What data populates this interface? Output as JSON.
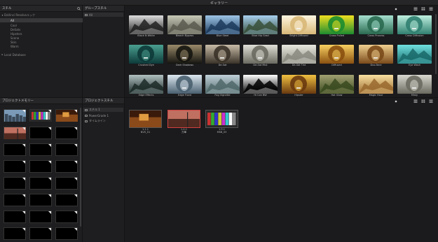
{
  "window": {
    "title": "ギャラリー"
  },
  "stills_panel": {
    "title": "スチル",
    "tree": [
      {
        "label": "DaVinci Resolveルック",
        "expanded": true,
        "selected": false
      },
      {
        "label": "All",
        "selected": true
      },
      {
        "label": "Cool",
        "selected": false
      },
      {
        "label": "DeSats",
        "selected": false
      },
      {
        "label": "Hipsters",
        "selected": false
      },
      {
        "label": "Scene",
        "selected": false
      },
      {
        "label": "Skin",
        "selected": false
      },
      {
        "label": "Warm",
        "selected": false
      },
      {
        "label": "Local Database",
        "expanded": false,
        "selected": false
      }
    ]
  },
  "group_stills_panel": {
    "title": "グループスチル",
    "groups": [
      {
        "label": "All"
      }
    ]
  },
  "looks": [
    {
      "label": "Black N White",
      "style": "bw"
    },
    {
      "label": "Bleach Bypass",
      "style": "bleach"
    },
    {
      "label": "Blue Steel",
      "style": "blue"
    },
    {
      "label": "Blue Hip Grad",
      "style": "bluegrad"
    },
    {
      "label": "Bright Diffused",
      "style": "bright"
    },
    {
      "label": "Cross Pulled",
      "style": "cross"
    },
    {
      "label": "Cross Process",
      "style": "crossproc"
    },
    {
      "label": "Cross Diffusion",
      "style": "crossdiff"
    },
    {
      "label": "Crushed Dye",
      "style": "crushed"
    },
    {
      "label": "Dark Shadows",
      "style": "dark"
    },
    {
      "label": "De-Sat",
      "style": "desat"
    },
    {
      "label": "De-Sat Mist",
      "style": "desatmist"
    },
    {
      "label": "De-Sat Tint",
      "style": "desattint"
    },
    {
      "label": "Diffused",
      "style": "diffused"
    },
    {
      "label": "Duo-Tone",
      "style": "duotone"
    },
    {
      "label": "Eye Wash",
      "style": "eyewash"
    },
    {
      "label": "Edge Effects",
      "style": "edge"
    },
    {
      "label": "Edge Fixed",
      "style": "edgefixed"
    },
    {
      "label": "Fog Vignette",
      "style": "fog"
    },
    {
      "label": "Hi Con BW",
      "style": "hicon"
    },
    {
      "label": "Hipster",
      "style": "hipster"
    },
    {
      "label": "Hot Glow",
      "style": "hotglow"
    },
    {
      "label": "Magic Hour",
      "style": "magic"
    },
    {
      "label": "Misty",
      "style": "misty"
    }
  ],
  "memory_panel": {
    "title": "プロジェクトメモリー",
    "slots": [
      {
        "filled": true,
        "kind": "city"
      },
      {
        "filled": true,
        "kind": "chart"
      },
      {
        "filled": true,
        "kind": "warm"
      },
      {
        "filled": true,
        "kind": "redcity"
      },
      {
        "filled": false
      },
      {
        "filled": false
      },
      {
        "filled": false
      },
      {
        "filled": false
      },
      {
        "filled": false
      },
      {
        "filled": false
      },
      {
        "filled": false
      },
      {
        "filled": false
      },
      {
        "filled": false
      },
      {
        "filled": false
      },
      {
        "filled": false
      },
      {
        "filled": false
      },
      {
        "filled": false
      },
      {
        "filled": false
      },
      {
        "filled": false
      },
      {
        "filled": false
      },
      {
        "filled": false
      },
      {
        "filled": false
      },
      {
        "filled": false
      },
      {
        "filled": false
      },
      {
        "filled": false
      },
      {
        "filled": false
      },
      {
        "filled": false
      },
      {
        "filled": false
      },
      {
        "filled": false
      },
      {
        "filled": false
      },
      {
        "filled": false
      }
    ]
  },
  "project_panel": {
    "title": "プロジェクトスチル",
    "tree": [
      {
        "label": "スチル 1",
        "active": true
      },
      {
        "label": "PowerGrade 1",
        "active": false
      },
      {
        "label": "タイムライン",
        "active": false
      }
    ],
    "stills": [
      {
        "id": "1.1.1",
        "name": "NVS_01",
        "kind": "warm",
        "selected": false
      },
      {
        "id": "1.4.1",
        "name": "万華",
        "kind": "redcity",
        "selected": true
      },
      {
        "id": "1.9.1",
        "name": "MSB_03",
        "kind": "chart",
        "selected": false
      }
    ]
  },
  "colors": {
    "accent_red": "#d04040",
    "panel_bg": "#1e1e20",
    "header_bg": "#262628"
  }
}
